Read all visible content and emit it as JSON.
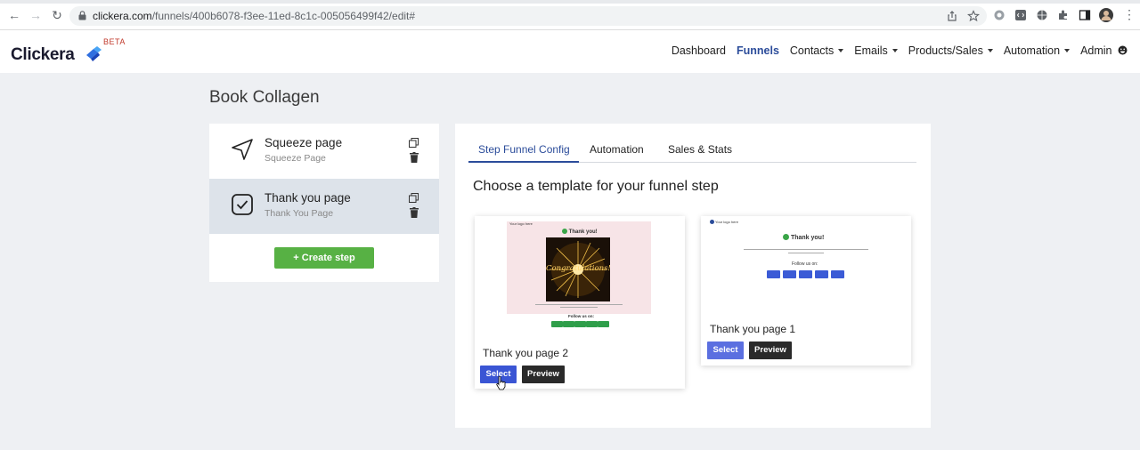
{
  "browser": {
    "url_host": "clickera.com",
    "url_path": "/funnels/400b6078-f3ee-11ed-8c1c-005056499f42/edit#"
  },
  "app": {
    "logo": "Clickera",
    "beta": "BETA",
    "brand_color": "#2b4c9a"
  },
  "nav": {
    "items": [
      {
        "label": "Dashboard",
        "dropdown": false,
        "active": false
      },
      {
        "label": "Funnels",
        "dropdown": false,
        "active": true
      },
      {
        "label": "Contacts",
        "dropdown": true,
        "active": false
      },
      {
        "label": "Emails",
        "dropdown": true,
        "active": false
      },
      {
        "label": "Products/Sales",
        "dropdown": true,
        "active": false
      },
      {
        "label": "Automation",
        "dropdown": true,
        "active": false
      },
      {
        "label": "Admin",
        "dropdown": false,
        "active": false
      }
    ]
  },
  "page": {
    "title": "Book Collagen"
  },
  "steps": {
    "items": [
      {
        "title": "Squeeze page",
        "subtitle": "Squeeze Page",
        "icon": "send-icon",
        "selected": false
      },
      {
        "title": "Thank you page",
        "subtitle": "Thank You Page",
        "icon": "checkbox-icon",
        "selected": true
      }
    ],
    "create_label": "+ Create step"
  },
  "config": {
    "tabs": [
      "Step Funnel Config",
      "Automation",
      "Sales & Stats"
    ],
    "active_tab": 0,
    "heading": "Choose a template for your funnel step",
    "templates": [
      {
        "name": "Thank you page 2",
        "select_label": "Select",
        "preview_label": "Preview",
        "thumb": {
          "brand": "Your logo here",
          "title": "Thank you!",
          "image_text": "Congratulations!",
          "follow": "Follow us on:"
        }
      },
      {
        "name": "Thank you page 1",
        "select_label": "Select",
        "preview_label": "Preview",
        "thumb": {
          "brand": "Your logo here",
          "title": "Thank you!",
          "follow": "Follow us on:"
        }
      }
    ]
  }
}
